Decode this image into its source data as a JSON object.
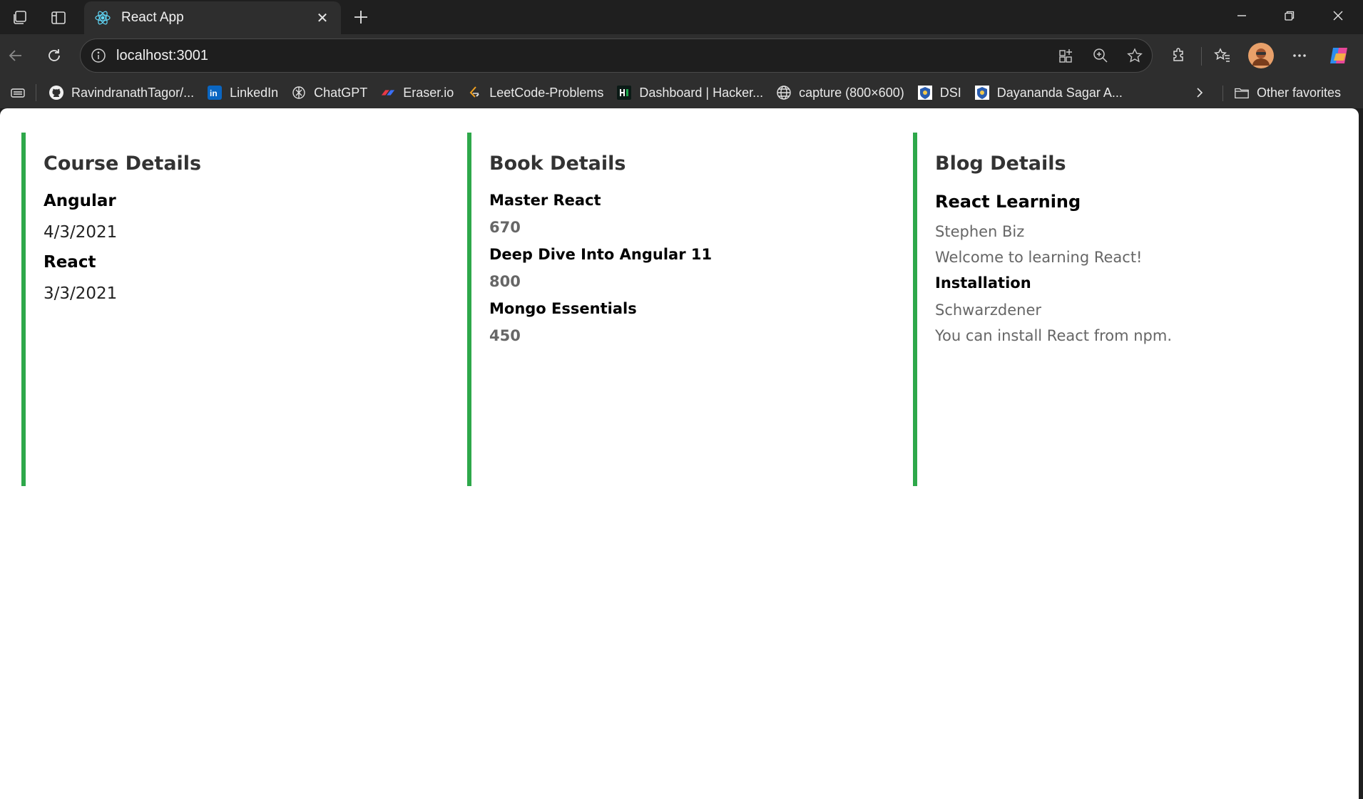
{
  "browser": {
    "tab_title": "React App",
    "url": "localhost:3001",
    "bookmarks": [
      {
        "label": "RavindranathTagor/...",
        "icon": "github-icon"
      },
      {
        "label": "LinkedIn",
        "icon": "linkedin-icon"
      },
      {
        "label": "ChatGPT",
        "icon": "chatgpt-icon"
      },
      {
        "label": "Eraser.io",
        "icon": "eraser-icon"
      },
      {
        "label": "LeetCode-Problems",
        "icon": "leetcode-icon"
      },
      {
        "label": "Dashboard | Hacker...",
        "icon": "hackerrank-icon"
      },
      {
        "label": "capture (800×600)",
        "icon": "globe-icon"
      },
      {
        "label": "DSI",
        "icon": "dsi-icon"
      },
      {
        "label": "Dayananda Sagar A...",
        "icon": "dsi-icon"
      }
    ],
    "other_favorites": "Other favorites",
    "accent": "#2ea84a"
  },
  "page": {
    "course": {
      "heading": "Course Details",
      "items": [
        {
          "name": "Angular",
          "date": "4/3/2021"
        },
        {
          "name": "React",
          "date": "3/3/2021"
        }
      ]
    },
    "books": {
      "heading": "Book Details",
      "items": [
        {
          "name": "Master React",
          "price": "670"
        },
        {
          "name": "Deep Dive Into Angular 11",
          "price": "800"
        },
        {
          "name": "Mongo Essentials",
          "price": "450"
        }
      ]
    },
    "blog": {
      "heading": "Blog Details",
      "items": [
        {
          "title": "React Learning",
          "author": "Stephen Biz",
          "text": "Welcome to learning React!"
        },
        {
          "title": "Installation",
          "author": "Schwarzdener",
          "text": "You can install React from npm."
        }
      ]
    }
  }
}
